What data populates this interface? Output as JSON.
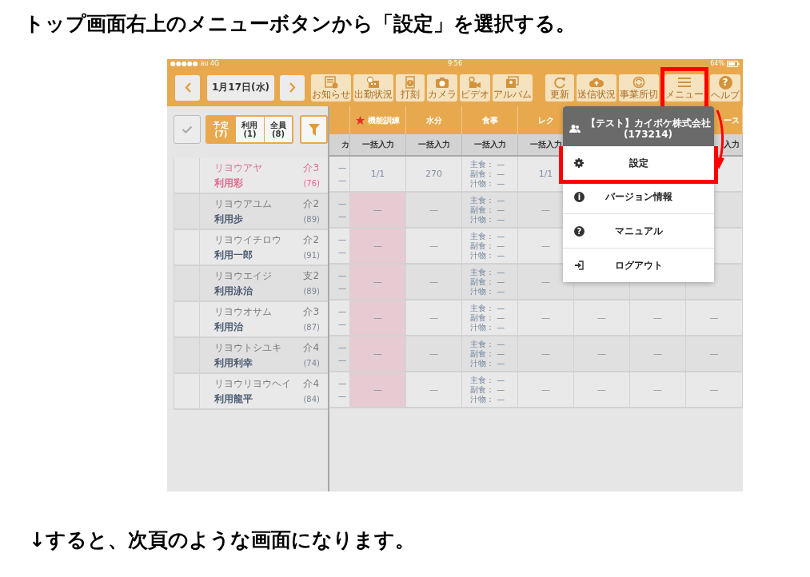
{
  "heading": "トップ画面右上のメニューボタンから「設定」を選択する。",
  "screen": {
    "status_bar": {
      "carrier": "●●●●● au 4G",
      "time": "9:56",
      "battery": "64%"
    },
    "toolbar": {
      "date": "1月17日(水)",
      "left_tools": [
        {
          "label": "お知らせ"
        },
        {
          "label": "出勤状況"
        },
        {
          "label": "打刻"
        },
        {
          "label": "カメラ"
        },
        {
          "label": "ビデオ"
        },
        {
          "label": "アルバム"
        }
      ],
      "right_tools": [
        {
          "label": "更新",
          "highlighted": false
        },
        {
          "label": "送信状況",
          "highlighted": false
        },
        {
          "label": "事業所切",
          "highlighted": false
        },
        {
          "label": "メニュー",
          "highlighted": true
        },
        {
          "label": "ヘルプ",
          "glyph": "?",
          "highlighted": false
        }
      ]
    },
    "filter": {
      "segments": [
        {
          "label": "予定",
          "count": "(7)",
          "selected": true
        },
        {
          "label": "利用",
          "count": "(1)",
          "selected": false
        },
        {
          "label": "全員",
          "count": "(8)",
          "selected": false
        }
      ]
    },
    "table": {
      "columns": [
        {
          "bulk": "カ"
        },
        {
          "label": "機能訓練",
          "starred": true,
          "bulk": "一括入力"
        },
        {
          "label": "水分",
          "bulk": "一括入力"
        },
        {
          "label": "食事",
          "bulk": "一括入力"
        },
        {
          "label": "レク",
          "bulk": "一括入力"
        },
        {},
        {},
        {
          "label": "ース",
          "bulk": "入力"
        }
      ],
      "rows": [
        {
          "kana": "リヨウアヤ",
          "level": "介3",
          "name": "利用彩",
          "age": "(76)",
          "highlighted": true,
          "cells": [
            {
              "lines": [
                "—",
                "—"
              ]
            },
            {
              "text": "1/1",
              "shaded": false
            },
            {
              "text": "270"
            },
            {
              "lines": [
                "主食： —",
                "副食： —",
                "汁物： —"
              ]
            },
            {
              "text": "1/1"
            },
            {},
            {},
            {}
          ]
        },
        {
          "kana": "リヨウアユム",
          "level": "介2",
          "name": "利用歩",
          "age": "(89)",
          "highlighted": false,
          "cells": [
            {
              "lines": [
                "—",
                "—"
              ]
            },
            {
              "text": "—",
              "shaded": true
            },
            {
              "text": "—"
            },
            {
              "lines": [
                "主食： —",
                "副食： —",
                "汁物： —"
              ]
            },
            {
              "text": "—"
            },
            {},
            {},
            {}
          ]
        },
        {
          "kana": "リヨウイチロウ",
          "level": "介2",
          "name": "利用一郎",
          "age": "(91)",
          "highlighted": false,
          "cells": [
            {
              "lines": [
                "—",
                "—"
              ]
            },
            {
              "text": "—",
              "shaded": true
            },
            {
              "text": "—"
            },
            {
              "lines": [
                "主食： —",
                "副食： —",
                "汁物： —"
              ]
            },
            {
              "text": "—"
            },
            {},
            {},
            {}
          ]
        },
        {
          "kana": "リヨウエイジ",
          "level": "支2",
          "name": "利用泳治",
          "age": "(89)",
          "highlighted": false,
          "cells": [
            {
              "lines": [
                "—",
                "—"
              ]
            },
            {
              "text": "—",
              "shaded": true
            },
            {
              "text": "—"
            },
            {
              "lines": [
                "主食： —",
                "副食： —",
                "汁物： —"
              ]
            },
            {
              "text": "—"
            },
            {},
            {},
            {}
          ]
        },
        {
          "kana": "リヨウオサム",
          "level": "介3",
          "name": "利用治",
          "age": "(87)",
          "highlighted": false,
          "cells": [
            {
              "lines": [
                "—",
                "—"
              ]
            },
            {
              "text": "—",
              "shaded": true
            },
            {
              "text": "—"
            },
            {
              "lines": [
                "主食： —",
                "副食： —",
                "汁物： —"
              ]
            },
            {
              "text": "—"
            },
            {
              "text": "—"
            },
            {
              "text": "—"
            },
            {
              "text": "—"
            }
          ]
        },
        {
          "kana": "リヨウトシユキ",
          "level": "介4",
          "name": "利用利幸",
          "age": "(74)",
          "highlighted": false,
          "cells": [
            {
              "lines": [
                "—",
                "—"
              ]
            },
            {
              "text": "—",
              "shaded": true
            },
            {
              "text": "—"
            },
            {
              "lines": [
                "主食： —",
                "副食： —",
                "汁物： —"
              ]
            },
            {
              "text": "—"
            },
            {
              "text": "—"
            },
            {
              "text": "—"
            },
            {
              "text": "—"
            }
          ]
        },
        {
          "kana": "リヨウリヨウヘイ",
          "level": "介4",
          "name": "利用龍平",
          "age": "(84)",
          "highlighted": false,
          "cells": [
            {
              "lines": [
                "—",
                "—"
              ]
            },
            {
              "text": "—",
              "shaded": true
            },
            {
              "text": "—"
            },
            {
              "lines": [
                "主食： —",
                "副食： —",
                "汁物： —"
              ]
            },
            {
              "text": "—"
            },
            {
              "text": "—"
            },
            {
              "text": "—"
            },
            {
              "text": "—"
            }
          ]
        }
      ]
    },
    "menu": {
      "account": "【テスト】カイポケ株式会社",
      "account_id": "(173214)",
      "items": [
        {
          "label": "設定",
          "highlighted": true
        },
        {
          "label": "バージョン情報",
          "glyph": "i",
          "highlighted": false
        },
        {
          "label": "マニュアル",
          "glyph": "?",
          "highlighted": false
        },
        {
          "label": "ログアウト",
          "highlighted": false
        }
      ]
    }
  },
  "footer": "↓すると、次頁のような画面になります。"
}
